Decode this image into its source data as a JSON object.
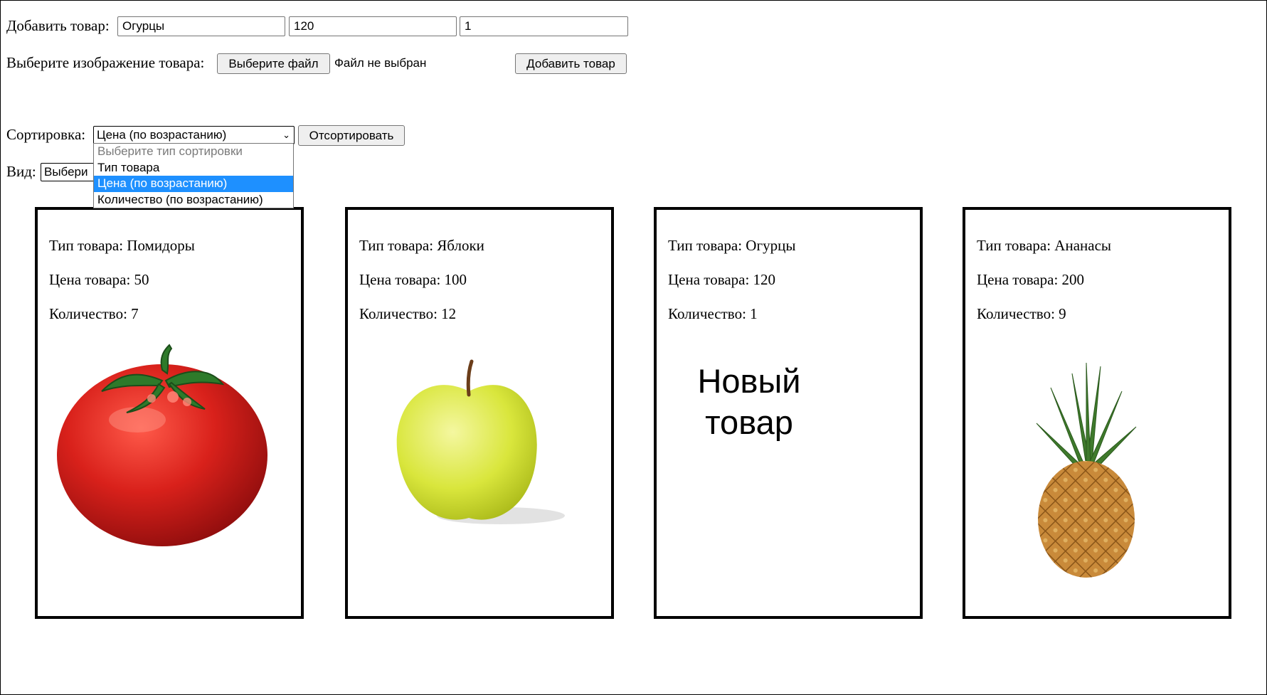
{
  "add_form": {
    "label": "Добавить товар:",
    "name_value": "Огурцы",
    "price_value": "120",
    "qty_value": "1",
    "image_label": "Выберите изображение товара:",
    "file_button": "Выберите файл",
    "file_status": "Файл не выбран",
    "submit_button": "Добавить товар"
  },
  "sort": {
    "label": "Сортировка:",
    "selected": "Цена (по возрастанию)",
    "button": "Отсортировать",
    "options": [
      "Выберите тип сортировки",
      "Тип товара",
      "Цена (по возрастанию)",
      "Количество (по возрастанию)"
    ]
  },
  "view": {
    "label": "Вид:",
    "selected_visible": "Выбери"
  },
  "products": [
    {
      "type": "Тип товара: Помидоры",
      "price": "Цена товара: 50",
      "qty": "Количество: 7",
      "image": "tomato-image"
    },
    {
      "type": "Тип товара: Яблоки",
      "price": "Цена товара: 100",
      "qty": "Количество: 12",
      "image": "apple-image"
    },
    {
      "type": "Тип товара: Огурцы",
      "price": "Цена товара: 120",
      "qty": "Количество: 1",
      "image": "new-product-placeholder",
      "placeholder_line1": "Новый",
      "placeholder_line2": "товар"
    },
    {
      "type": "Тип товара: Ананасы",
      "price": "Цена товара: 200",
      "qty": "Количество: 9",
      "image": "pineapple-image"
    }
  ],
  "colors": {
    "selected_option_bg": "#1e90ff",
    "button_bg": "#efefef",
    "tomato": "#d11a1a",
    "apple": "#d8e63a",
    "pineapple_leaf": "#3f7a2c",
    "pineapple_body": "#c98a3a"
  }
}
